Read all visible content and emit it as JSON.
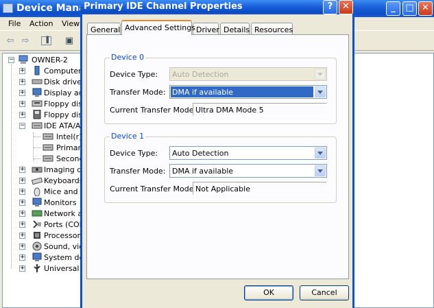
{
  "device_manager": {
    "title": "Device Manager",
    "menu": [
      "File",
      "Action",
      "View"
    ],
    "tree": {
      "root": "OWNER-2",
      "items": [
        "Computer",
        "Disk drives",
        "Display ada",
        "Floppy disk",
        "Floppy disk",
        "IDE ATA/AT"
      ],
      "ide_children": [
        "Intel(r)",
        "Primary",
        "Second"
      ],
      "items_after": [
        "Imaging de",
        "Keyboards",
        "Mice and ot",
        "Monitors",
        "Network ac",
        "Ports (COM",
        "Processors",
        "Sound, vide",
        "System dev",
        "Universal S"
      ]
    }
  },
  "dialog": {
    "title": "Primary IDE Channel Properties",
    "tabs": [
      "General",
      "Advanced Settings",
      "Driver",
      "Details",
      "Resources"
    ],
    "active_tab": "Advanced Settings",
    "device0": {
      "legend": "Device 0",
      "device_type_label": "Device Type:",
      "device_type_value": "Auto Detection",
      "transfer_mode_label": "Transfer Mode:",
      "transfer_mode_value": "DMA if available",
      "current_mode_label": "Current Transfer Mode:",
      "current_mode_value": "Ultra DMA Mode 5"
    },
    "device1": {
      "legend": "Device 1",
      "device_type_label": "Device Type:",
      "device_type_value": "Auto Detection",
      "transfer_mode_label": "Transfer Mode:",
      "transfer_mode_value": "DMA if available",
      "current_mode_label": "Current Transfer Mode:",
      "current_mode_value": "Not Applicable"
    },
    "ok_label": "OK",
    "cancel_label": "Cancel",
    "help_glyph": "?",
    "close_glyph": "✕"
  },
  "colors": {
    "titlebar": "#0c4fc7",
    "selection": "#316ac5",
    "group_legend": "#0046d5",
    "active_tab_accent": "#e68b2c"
  }
}
